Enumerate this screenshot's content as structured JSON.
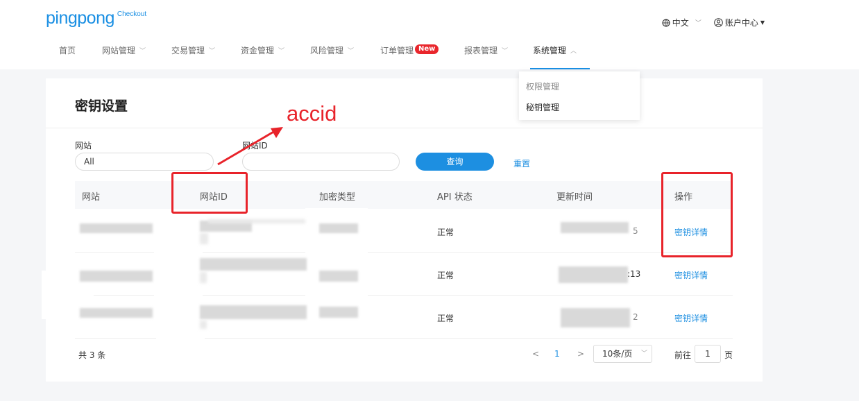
{
  "header": {
    "logo_main": "pingpong",
    "logo_sub": "Checkout",
    "language": "中文",
    "account": "账户中心"
  },
  "nav": {
    "items": [
      {
        "label": "首页"
      },
      {
        "label": "网站管理"
      },
      {
        "label": "交易管理"
      },
      {
        "label": "资金管理"
      },
      {
        "label": "风险管理"
      },
      {
        "label": "订单管理"
      },
      {
        "label": "报表管理"
      },
      {
        "label": "系统管理"
      }
    ],
    "new_badge": "New",
    "dropdown": [
      "权限管理",
      "秘钥管理"
    ]
  },
  "page": {
    "title": "密钥设置"
  },
  "filters": {
    "site_label": "网站",
    "site_value": "All",
    "siteid_label": "网站ID",
    "siteid_value": "",
    "query_button": "查询",
    "reset_button": "重置"
  },
  "table": {
    "headers": [
      "网站",
      "网站ID",
      "加密类型",
      "API 状态",
      "更新时间",
      "操作"
    ],
    "rows": [
      {
        "status": "正常",
        "time_tail": "5",
        "action": "密钥详情"
      },
      {
        "status": "正常",
        "time_tail": ":13",
        "action": "密钥详情"
      },
      {
        "status": "正常",
        "time_tail": "2",
        "action": "密钥详情"
      }
    ]
  },
  "pagination": {
    "total": "共 3 条",
    "prev": "<",
    "current": "1",
    "next": ">",
    "page_size": "10条/页",
    "goto_label": "前往",
    "goto_value": "1",
    "page_label": "页"
  },
  "annotation": {
    "text": "accid",
    "color": "#e8232a"
  },
  "colors": {
    "brand": "#1a8fe3",
    "primary_button": "#1d8fe1",
    "badge": "#e9262c"
  }
}
